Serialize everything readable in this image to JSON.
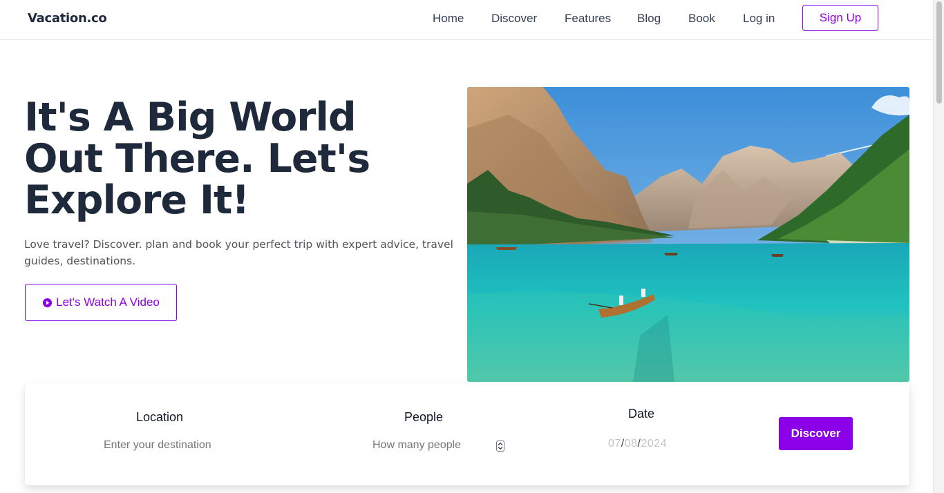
{
  "header": {
    "logo": "Vacation.co",
    "nav": [
      "Home",
      "Discover",
      "Features",
      "Blog",
      "Book",
      "Log in"
    ],
    "signup_label": "Sign Up"
  },
  "hero": {
    "title_lines": [
      "It's A Big World",
      "Out There. Let's",
      "Explore It!"
    ],
    "subtitle": "Love travel? Discover. plan and book your perfect trip with expert advice, travel guides, destinations.",
    "video_button": "Let's Watch A Video",
    "image_icon": "mountain-lake-photo"
  },
  "search": {
    "location_label": "Location",
    "location_placeholder": "Enter your destination",
    "people_label": "People",
    "people_placeholder": "How many people",
    "date_label": "Date",
    "date_month": "07",
    "date_day": "08",
    "date_year": "2024",
    "date_separator": "/",
    "discover_button": "Discover"
  },
  "colors": {
    "accent": "#8b00e8",
    "heading": "#1e293b"
  }
}
